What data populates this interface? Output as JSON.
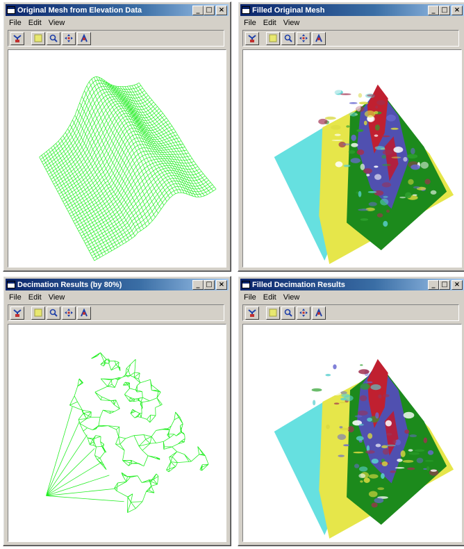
{
  "windows": [
    {
      "title": "Original Mesh from Elevation Data",
      "menu": [
        "File",
        "Edit",
        "View"
      ],
      "view": "wire-dense"
    },
    {
      "title": "Filled Original Mesh",
      "menu": [
        "File",
        "Edit",
        "View"
      ],
      "view": "filled"
    },
    {
      "title": "Decimation Results (by 80%)",
      "menu": [
        "File",
        "Edit",
        "View"
      ],
      "view": "wire-sparse"
    },
    {
      "title": "Filled Decimation Results",
      "menu": [
        "File",
        "Edit",
        "View"
      ],
      "view": "filled"
    }
  ],
  "controls": {
    "minimize": "_",
    "maximize": "□",
    "close": "×"
  },
  "toolbar_icons": [
    "mesh-select-icon",
    "fill-icon",
    "zoom-icon",
    "pan-icon",
    "rotate-icon"
  ],
  "colors": {
    "wire": "#22ee22",
    "plane": "#66e0e0",
    "titlebar": "#0a246a"
  }
}
